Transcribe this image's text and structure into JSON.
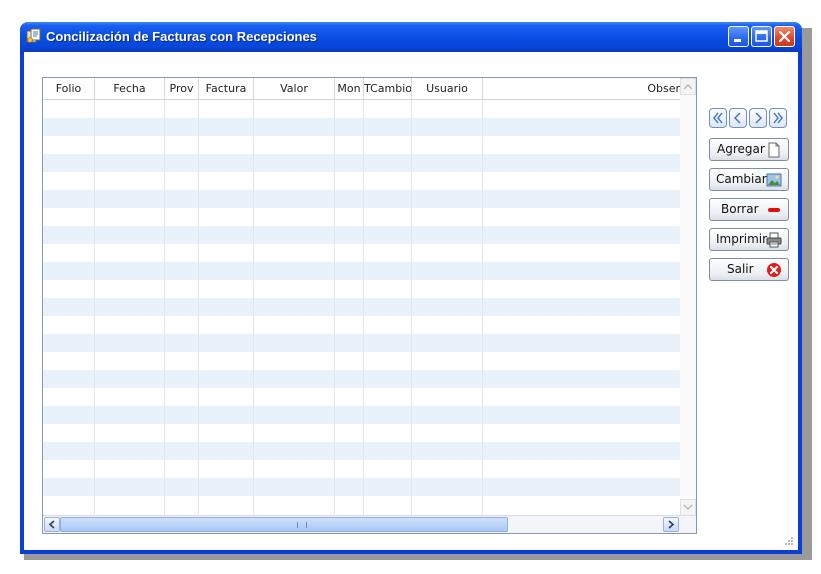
{
  "window": {
    "title": "Concilización de Facturas con Recepciones"
  },
  "grid": {
    "columns": [
      "Folio",
      "Fecha",
      "Prov",
      "Factura",
      "Valor",
      "Mon",
      "TCambio",
      "Usuario",
      "Obser"
    ],
    "rows": []
  },
  "nav": {
    "first_icon": "double-chevron-left-icon",
    "prev_icon": "chevron-left-icon",
    "next_icon": "chevron-right-icon",
    "last_icon": "double-chevron-right-icon"
  },
  "actions": {
    "add_label": "Agregar",
    "change_label": "Cambiar",
    "delete_label": "Borrar",
    "print_label": "Imprimir",
    "exit_label": "Salir"
  },
  "colors": {
    "titlebar": "#0a4ee3",
    "row_alt": "#e9f1fb",
    "close_red": "#e0462a"
  }
}
